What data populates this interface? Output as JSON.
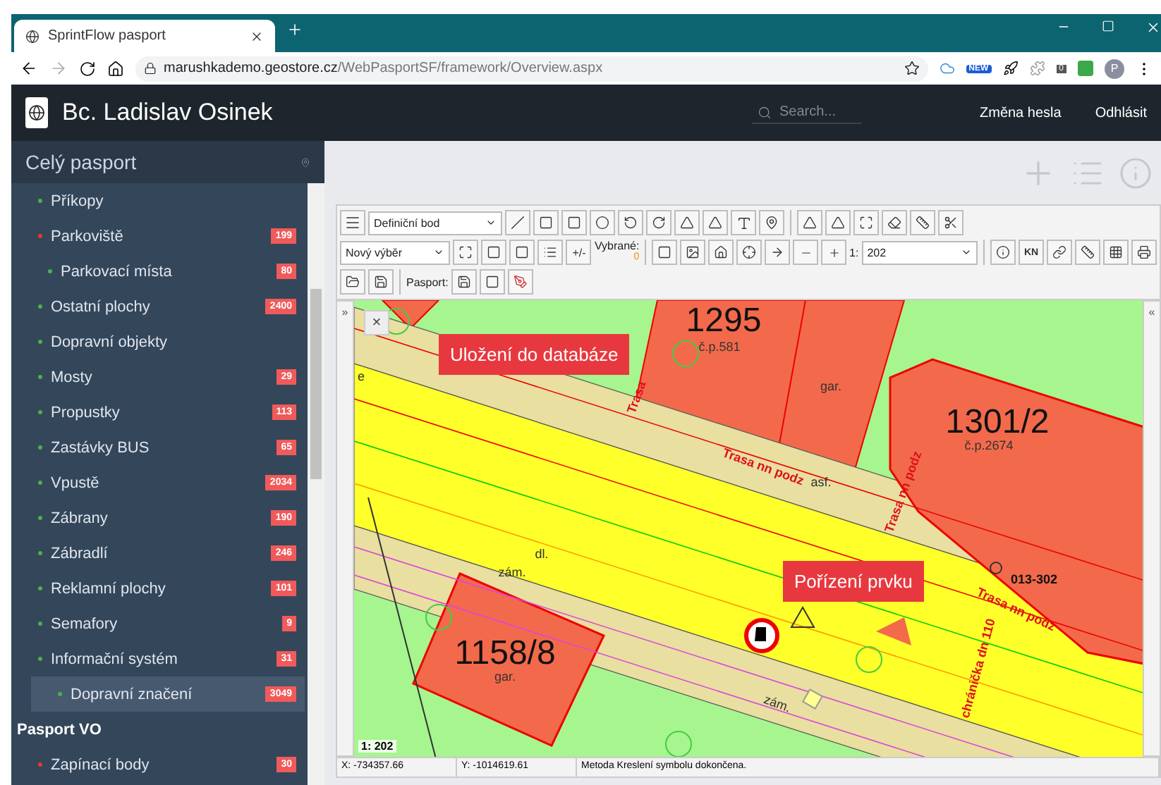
{
  "browser": {
    "tab_title": "SprintFlow pasport",
    "url_host": "marushkademo.geostore.cz",
    "url_path": "/WebPasportSF/framework/Overview.aspx",
    "extension_badge": "NEW",
    "extension_count": "0",
    "profile_letter": "P"
  },
  "header": {
    "user_name": "Bc. Ladislav Osinek",
    "search_placeholder": "Search...",
    "links": [
      "Změna hesla",
      "Odhlásit"
    ]
  },
  "sidebar": {
    "title": "Celý pasport",
    "items": [
      {
        "label": "Příkopy",
        "color": "#4caf50",
        "selected": false
      },
      {
        "label": "Parkoviště",
        "color": "#e53935",
        "count": "199",
        "selected": false,
        "children": [
          {
            "label": "Parkovací místa",
            "color": "#4caf50",
            "count": "80",
            "selected": false
          }
        ]
      },
      {
        "label": "Ostatní plochy",
        "color": "#4caf50",
        "count": "2400",
        "selected": false
      },
      {
        "label": "Dopravní objekty",
        "color": "#4caf50",
        "selected": false
      },
      {
        "label": "Mosty",
        "color": "#4caf50",
        "count": "29",
        "selected": false
      },
      {
        "label": "Propustky",
        "color": "#4caf50",
        "count": "113",
        "selected": false
      },
      {
        "label": "Zastávky BUS",
        "color": "#4caf50",
        "count": "65",
        "selected": false
      },
      {
        "label": "Vpustě",
        "color": "#4caf50",
        "count": "2034",
        "selected": false
      },
      {
        "label": "Zábrany",
        "color": "#4caf50",
        "count": "190",
        "selected": false
      },
      {
        "label": "Zábradlí",
        "color": "#4caf50",
        "count": "246",
        "selected": false
      },
      {
        "label": "Reklamní plochy",
        "color": "#4caf50",
        "count": "101",
        "selected": false
      },
      {
        "label": "Semafory",
        "color": "#4caf50",
        "count": "9",
        "selected": false
      },
      {
        "label": "Informační systém",
        "color": "#4caf50",
        "count": "31",
        "selected": false
      },
      {
        "label": "Dopravní značení",
        "color": "#4caf50",
        "count": "3049",
        "selected": true
      }
    ],
    "section_title": "Pasport VO",
    "section_items": [
      {
        "label": "Zapínací body",
        "color": "#e53935",
        "count": "30",
        "selected": false
      }
    ]
  },
  "toolbar": {
    "draw_select": "Definiční bod",
    "selection_select": "Nový výběr",
    "plus_minus": "+/-",
    "selected_label": "Vybrané:",
    "selected_count": "0",
    "scale_prefix": "1:",
    "scale_value": "202",
    "kn": "KN",
    "pasport_label": "Pasport:"
  },
  "map": {
    "close": "×",
    "left_toggle": "»",
    "right_toggle": "«",
    "scale_text": "1: 202",
    "labels": [
      {
        "text": "1295",
        "kind": "parcel"
      },
      {
        "text": "č.p.581",
        "kind": "note"
      },
      {
        "text": "gar.",
        "kind": "note"
      },
      {
        "text": "1301/2",
        "kind": "parcel"
      },
      {
        "text": "č.p.2674",
        "kind": "note"
      },
      {
        "text": "Trasa",
        "kind": "line"
      },
      {
        "text": "Trasa nn podz",
        "kind": "line"
      },
      {
        "text": "asf.",
        "kind": "note"
      },
      {
        "text": "Trasa nn podz",
        "kind": "line"
      },
      {
        "text": "e",
        "kind": "note"
      },
      {
        "text": "dl.",
        "kind": "note"
      },
      {
        "text": "zám.",
        "kind": "note"
      },
      {
        "text": "1158/8",
        "kind": "parcel"
      },
      {
        "text": "gar.",
        "kind": "note"
      },
      {
        "text": "zám.",
        "kind": "note"
      },
      {
        "text": "013-302",
        "kind": "code"
      },
      {
        "text": "Trasa nn podz",
        "kind": "line"
      },
      {
        "text": "chránička dn 110",
        "kind": "line"
      }
    ],
    "callouts": [
      "Uložení do databáze",
      "Pořízení prvku"
    ]
  },
  "status": {
    "x": "X: -734357.66",
    "y": "Y: -1014619.61",
    "message": "Metoda Kreslení symbolu dokončena."
  }
}
